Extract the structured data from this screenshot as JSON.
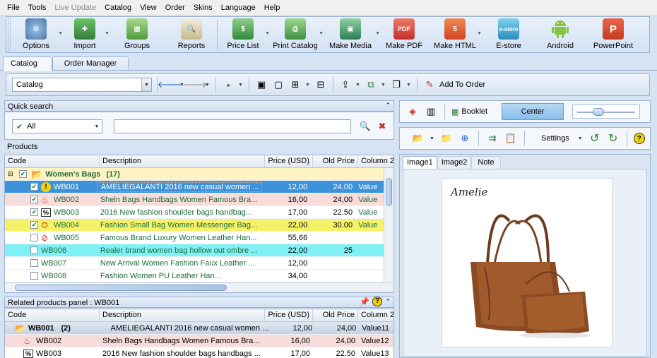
{
  "menu": [
    "File",
    "Tools",
    "Live Update",
    "Catalog",
    "View",
    "Order",
    "Skins",
    "Language",
    "Help"
  ],
  "ribbon": {
    "options": "Options",
    "import": "Import",
    "groups": "Groups",
    "reports": "Reports",
    "price_list": "Price List",
    "print_catalog": "Print Catalog",
    "make_media": "Make Media",
    "make_pdf": "Make PDF",
    "make_html": "Make HTML",
    "estore": "E-store",
    "android": "Android",
    "powerpoint": "PowerPoint",
    "pdf_badge": "PDF",
    "html_badge": "5",
    "estore_badge": "e-store",
    "ppt_badge": "P"
  },
  "tabs": {
    "catalog": "Catalog",
    "order_manager": "Order Manager"
  },
  "toolbar2": {
    "catalog_select": "Catalog",
    "add_to_order": "Add To Order"
  },
  "quick_search": {
    "title": "Quick search",
    "filter": "All",
    "query": ""
  },
  "products": {
    "title": "Products",
    "columns": [
      "Code",
      "Description",
      "Price (USD)",
      "Old Price",
      "Column 2"
    ],
    "group": {
      "name": "Women's Bags",
      "count": "(17)"
    },
    "rows": [
      {
        "code": "WB001",
        "desc": "AMELIEGALANTI 2016 new casual women ...",
        "price": "12,00",
        "old": "24,00",
        "col2": "Value"
      },
      {
        "code": "WB002",
        "desc": "Sheln Bags Handbags Women Famous Bra...",
        "price": "16,00",
        "old": "24,00",
        "col2": "Value"
      },
      {
        "code": "WB003",
        "desc": "2016 New fashion shoulder bags handbag...",
        "price": "17,00",
        "old": "22.50",
        "col2": "Value"
      },
      {
        "code": "WB004",
        "desc": "Fashion Small Bag Women Messenger Bag...",
        "price": "22,00",
        "old": "30.00",
        "col2": "Value"
      },
      {
        "code": "WB005",
        "desc": "Famous Brand Luxury Women Leather Han...",
        "price": "55,66",
        "old": "",
        "col2": ""
      },
      {
        "code": "WB006",
        "desc": "Realer brand women bag hollow out ombre ...",
        "price": "22,00",
        "old": "25",
        "col2": ""
      },
      {
        "code": "WB007",
        "desc": "New Arrival Women Fashion Faux Leather ...",
        "price": "12,00",
        "old": "",
        "col2": ""
      },
      {
        "code": "WB008",
        "desc": "Fashion Women PU Leather Han...",
        "price": "34,00",
        "old": "",
        "col2": ""
      }
    ]
  },
  "related": {
    "title": "Related products panel : WB001",
    "columns": [
      "Code",
      "Description",
      "Price (USD)",
      "Old Price",
      "Column 2"
    ],
    "group": {
      "code": "WB001",
      "count": "(2)",
      "desc": "AMELIEGALANTI 2016 new casual women ...",
      "price": "12,00",
      "old": "24,00",
      "col2": "Value11"
    },
    "rows": [
      {
        "code": "WB002",
        "desc": "Sheln Bags Handbags Women Famous Bra...",
        "price": "16,00",
        "old": "24,00",
        "col2": "Value12"
      },
      {
        "code": "WB003",
        "desc": "2016 New fashion shoulder bags handbags ...",
        "price": "17,00",
        "old": "22.50",
        "col2": "Value13"
      }
    ]
  },
  "right": {
    "booklet": "Booklet",
    "center": "Center",
    "settings": "Settings",
    "help": "?",
    "image_tabs": [
      "Image1",
      "Image2",
      "Note"
    ],
    "brand": "Amelie"
  },
  "colors": {
    "selected": "#3d93d9",
    "pink": "#f7dcdc",
    "yellow": "#f5f26a",
    "cyan": "#7ff0f5",
    "group": "#fff3c4"
  },
  "icons": {
    "options": "gear-icon",
    "import": "import-icon",
    "groups": "groups-icon",
    "reports": "magnifier-icon",
    "price_list": "dollar-icon",
    "print_catalog": "printer-icon",
    "make_media": "media-icon",
    "make_pdf": "pdf-icon",
    "make_html": "html5-icon",
    "estore": "estore-icon",
    "android": "android-icon",
    "powerpoint": "powerpoint-icon"
  }
}
